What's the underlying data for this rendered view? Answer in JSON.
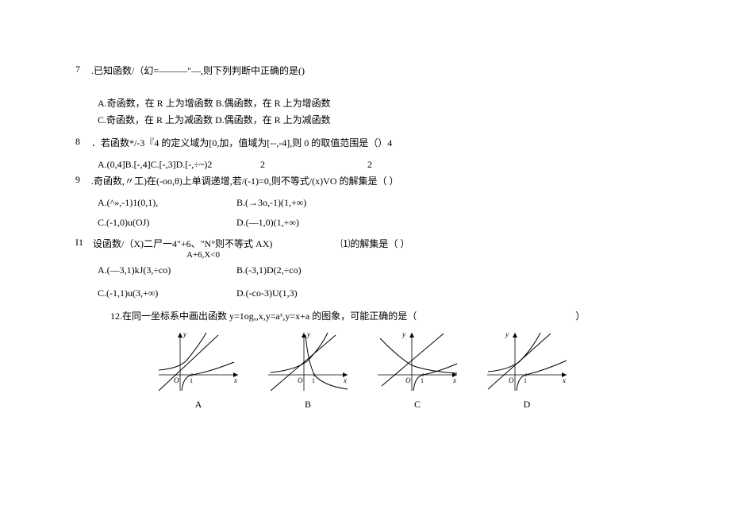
{
  "q7": {
    "num": "7",
    "text": ".已知函数/（幻=———\"—,则下列判断中正确的是()",
    "frac_symbol": "，",
    "optA": "A.奇函数，在 R 上为增函数 B.偶函数，在 R 上为增函数",
    "optC": "C.奇函数，在 R 上为减函数 D.偶函数，在 R 上为减函数"
  },
  "q8": {
    "num": "8",
    "text": "．若函数*/-3『4 的定义域为[0,加，值域为[--,-4],则 0 的取值范围是（）4",
    "opts": "A.(0,4]B.[-,4]C.[-,3]D.[-,÷~)2",
    "mid2a": "2",
    "mid2b": "2"
  },
  "q9": {
    "num": "9",
    "text": ".奇函数,〃工)在(-oo,θ)上单调递增,若/(-1)=0,则不等式/(x)VO 的解集是（            ）",
    "optA": "A.(^»,-1)1(0,1),",
    "optB": "B.(→3o,-1)(1,+∞)",
    "optC": "C.(-1,0)u(OJ)",
    "optD": "D.(—1,0)(1,+∞)"
  },
  "q11": {
    "num": "I1",
    "text": "设函数/（X)二尸一4\"+6、\"N°则不等式 AX)",
    "sub": "A+6,X<0",
    "tail": "⑴的解集是（            ）",
    "optA": "A.(—3,1)kJ(3,÷co)",
    "optB": "B.(-3,1)D(2,÷co)",
    "optC": "C.(-1,1)u(3,+∞)",
    "optD": "D.(-co-3)U(1,3)"
  },
  "q12": {
    "text": "12.在同一坐标系中画出函数 y=1og,,x,y=aˣ,y=x+a 的图象，可能正确的是（",
    "tail": "）",
    "labels": {
      "a": "A",
      "b": "B",
      "c": "C",
      "d": "D"
    },
    "axis": {
      "x": "x",
      "y": "y",
      "o": "O",
      "one": "1"
    }
  }
}
